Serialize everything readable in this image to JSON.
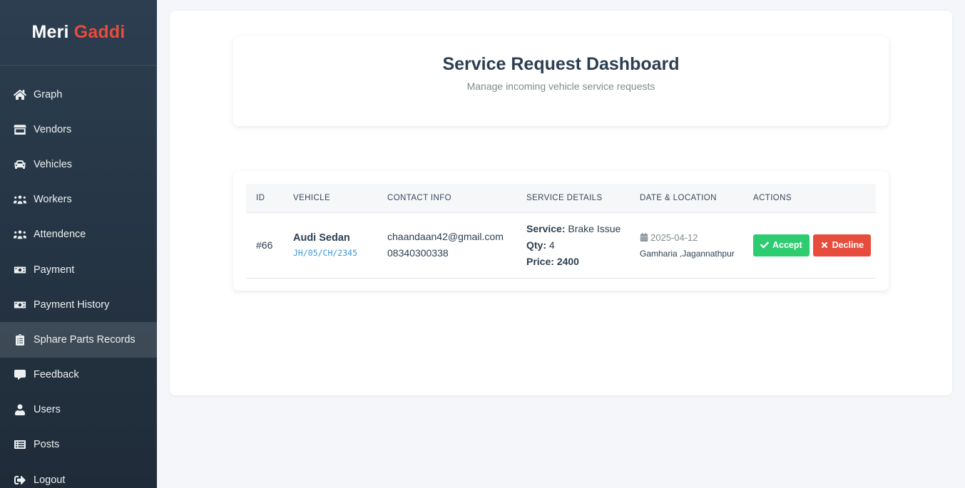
{
  "brand": {
    "part1": "Meri",
    "part2": "Gaddi"
  },
  "sidebar": {
    "items": [
      {
        "label": "Graph",
        "icon": "home-icon"
      },
      {
        "label": "Vendors",
        "icon": "store-icon"
      },
      {
        "label": "Vehicles",
        "icon": "car-icon"
      },
      {
        "label": "Workers",
        "icon": "users-icon"
      },
      {
        "label": "Attendence",
        "icon": "users-icon"
      },
      {
        "label": "Payment",
        "icon": "money-bill-icon"
      },
      {
        "label": "Payment History",
        "icon": "money-bill-icon"
      },
      {
        "label": "Sphare Parts Records",
        "icon": "clipboard-icon",
        "active": true
      },
      {
        "label": "Feedback",
        "icon": "comment-icon"
      },
      {
        "label": "Users",
        "icon": "user-icon"
      },
      {
        "label": "Posts",
        "icon": "list-icon"
      },
      {
        "label": "Logout",
        "icon": "logout-icon"
      }
    ]
  },
  "header": {
    "title": "Service Request Dashboard",
    "subtitle": "Manage incoming vehicle service requests"
  },
  "table": {
    "columns": [
      "ID",
      "VEHICLE",
      "CONTACT INFO",
      "SERVICE DETAILS",
      "DATE & LOCATION",
      "ACTIONS"
    ],
    "rows": [
      {
        "id": "#66",
        "vehicle_name": "Audi Sedan",
        "vehicle_plate": "JH/05/CH/2345",
        "email": "chaandaan42@gmail.com",
        "phone": "08340300338",
        "service_label": "Service:",
        "service_value": "Brake Issue",
        "qty_label": "Qty:",
        "qty_value": "4",
        "price_label": "Price:",
        "price_value": "2400",
        "date": "2025-04-12",
        "location": "Gamharia ,Jagannathpur",
        "accept_label": "Accept",
        "decline_label": "Decline"
      }
    ]
  },
  "colors": {
    "sidebar_bg": "#2c3e50",
    "brand_accent": "#e74c3c",
    "accept": "#2ecc71",
    "decline": "#e74c3c",
    "plate": "#3498db"
  }
}
